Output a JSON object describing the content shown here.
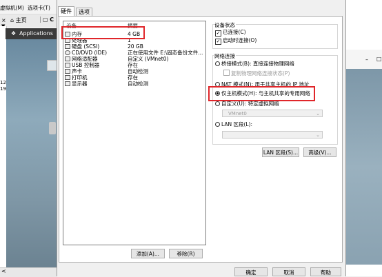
{
  "background": {
    "menu_vm": "虚拟机(M)",
    "menu_tabs": "选项卡(T)",
    "tab_home": "主页",
    "tab_other": "C",
    "applications": "Applications",
    "side_num_1": "12",
    "side_num_2": "19",
    "right_min": "–",
    "right_max": "□",
    "left_arrow": "<"
  },
  "dialog": {
    "tabs": [
      "硬件",
      "选项"
    ],
    "device_header": {
      "device": "设备",
      "summary": "摘要"
    },
    "devices": [
      {
        "name": "内存",
        "summary": "4 GB",
        "icon": "memory-icon"
      },
      {
        "name": "处理器",
        "summary": "1",
        "icon": "cpu-icon"
      },
      {
        "name": "硬盘 (SCSI)",
        "summary": "20 GB",
        "icon": "disk-icon"
      },
      {
        "name": "CD/DVD (IDE)",
        "summary": "正在使用文件 E:\\固态备份文件...",
        "icon": "cd-icon"
      },
      {
        "name": "网络适配器",
        "summary": "自定义 (VMnet0)",
        "icon": "network-icon"
      },
      {
        "name": "USB 控制器",
        "summary": "存在",
        "icon": "usb-icon"
      },
      {
        "name": "声卡",
        "summary": "自动检测",
        "icon": "sound-icon"
      },
      {
        "name": "打印机",
        "summary": "存在",
        "icon": "printer-icon"
      },
      {
        "name": "显示器",
        "summary": "自动检测",
        "icon": "display-icon"
      }
    ],
    "add_button": "添加(A)...",
    "remove_button": "移除(R)",
    "device_status": {
      "title": "设备状态",
      "connected": "已连接(C)",
      "connect_on_power": "启动时连接(O)"
    },
    "network": {
      "title": "网络连接",
      "bridged": "桥接模式(B): 直接连接物理网络",
      "replicate": "复制物理网络连接状态(P)",
      "nat": "NAT 模式(N): 用于共享主机的 IP 地址",
      "host_only": "仅主机模式(H): 与主机共享的专用网络",
      "custom": "自定义(U): 特定虚拟网络",
      "custom_value": "VMnet0",
      "lan": "LAN 区段(L):",
      "lan_segments_button": "LAN 区段(S)...",
      "advanced_button": "高级(V)..."
    },
    "ok": "确定",
    "cancel": "取消",
    "help": "帮助"
  }
}
